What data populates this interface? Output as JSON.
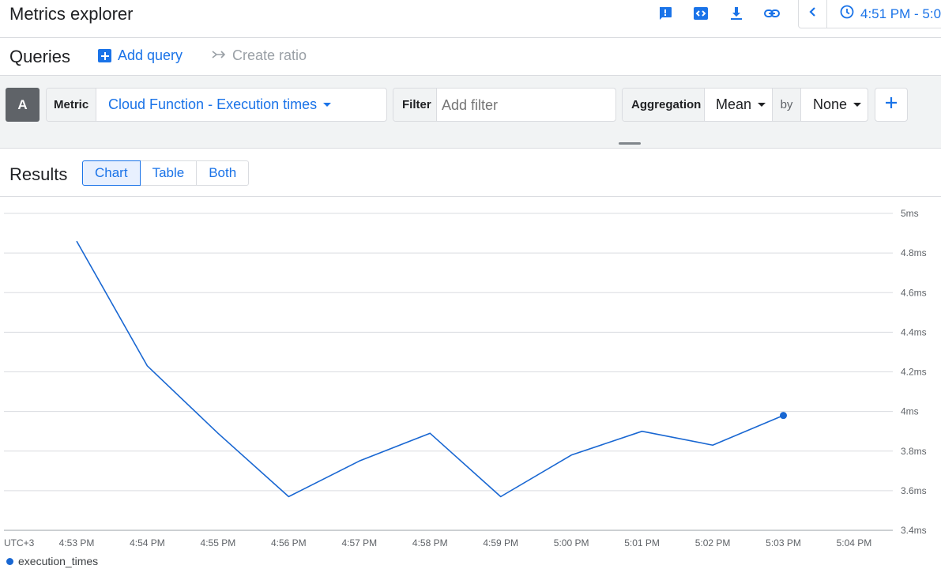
{
  "app": {
    "title": "Metrics explorer"
  },
  "toolbar": {
    "icons": [
      "feedback-icon",
      "code-icon",
      "download-icon",
      "link-icon"
    ],
    "time_range": "4:51 PM - 5:0"
  },
  "queries": {
    "title": "Queries",
    "add_query": "Add query",
    "create_ratio": "Create ratio"
  },
  "query": {
    "letter": "A",
    "metric_label": "Metric",
    "metric_value": "Cloud Function - Execution times",
    "filter_label": "Filter",
    "filter_placeholder": "Add filter",
    "aggregation_label": "Aggregation",
    "aggregation_value": "Mean",
    "by_label": "by",
    "by_value": "None"
  },
  "results": {
    "title": "Results",
    "tabs": [
      "Chart",
      "Table",
      "Both"
    ],
    "active_tab": "Chart"
  },
  "colors": {
    "accent": "#1a73e8",
    "series": "#1967d2"
  },
  "chart_data": {
    "type": "line",
    "timezone_label": "UTC+3",
    "x": [
      "4:53 PM",
      "4:54 PM",
      "4:55 PM",
      "4:56 PM",
      "4:57 PM",
      "4:58 PM",
      "4:59 PM",
      "5:00 PM",
      "5:01 PM",
      "5:02 PM",
      "5:03 PM",
      "5:04 PM"
    ],
    "series": [
      {
        "name": "execution_times",
        "values": [
          4.86,
          4.23,
          3.89,
          3.57,
          3.75,
          3.89,
          3.57,
          3.78,
          3.9,
          3.83,
          3.98,
          null
        ]
      }
    ],
    "y_ticks": [
      "5ms",
      "4.8ms",
      "4.6ms",
      "4.4ms",
      "4.2ms",
      "4ms",
      "3.8ms",
      "3.6ms",
      "3.4ms"
    ],
    "ylim": [
      3.4,
      5.0
    ],
    "y_unit": "ms",
    "grid": true,
    "legend_position": "bottom-left"
  }
}
